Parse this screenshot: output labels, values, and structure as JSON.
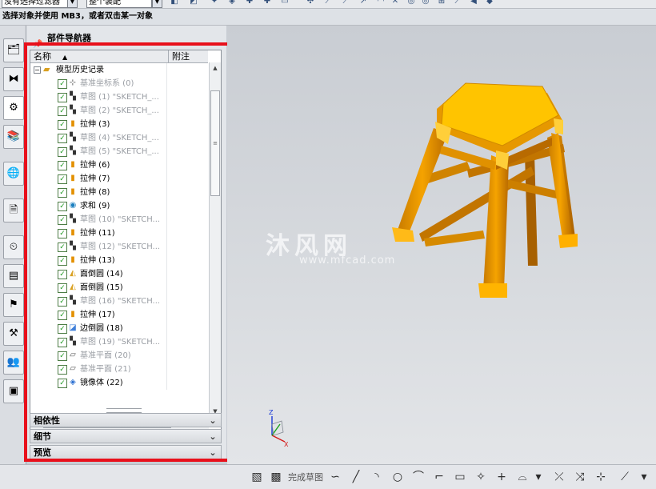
{
  "toolbar": {
    "selection_filter": "没有选择过滤器",
    "selection_scope": "整个装配"
  },
  "cue_line": "选择对象并使用 MB3，或者双击某一对象",
  "navigator": {
    "title": "部件导航器",
    "columns": {
      "name": "名称",
      "note": "附注"
    },
    "root_label": "模型历史记录",
    "features": [
      {
        "type": "datum-csys",
        "label": "基准坐标系 (0)",
        "suppressed": true
      },
      {
        "type": "sketch",
        "label": "草图 (1) \"SKETCH_...",
        "suppressed": true
      },
      {
        "type": "sketch",
        "label": "草图 (2) \"SKETCH_...",
        "suppressed": true
      },
      {
        "type": "extrude",
        "label": "拉伸 (3)",
        "suppressed": false
      },
      {
        "type": "sketch",
        "label": "草图 (4) \"SKETCH_...",
        "suppressed": true
      },
      {
        "type": "sketch",
        "label": "草图 (5) \"SKETCH_...",
        "suppressed": true
      },
      {
        "type": "extrude",
        "label": "拉伸 (6)",
        "suppressed": false
      },
      {
        "type": "extrude",
        "label": "拉伸 (7)",
        "suppressed": false
      },
      {
        "type": "extrude",
        "label": "拉伸 (8)",
        "suppressed": false
      },
      {
        "type": "unite",
        "label": "求和 (9)",
        "suppressed": false
      },
      {
        "type": "sketch",
        "label": "草图 (10) \"SKETCH...",
        "suppressed": true
      },
      {
        "type": "extrude",
        "label": "拉伸 (11)",
        "suppressed": false
      },
      {
        "type": "sketch",
        "label": "草图 (12) \"SKETCH...",
        "suppressed": true
      },
      {
        "type": "extrude",
        "label": "拉伸 (13)",
        "suppressed": false
      },
      {
        "type": "face-blend",
        "label": "面倒圆 (14)",
        "suppressed": false
      },
      {
        "type": "face-blend",
        "label": "面倒圆 (15)",
        "suppressed": false
      },
      {
        "type": "sketch",
        "label": "草图 (16) \"SKETCH...",
        "suppressed": true
      },
      {
        "type": "extrude",
        "label": "拉伸 (17)",
        "suppressed": false
      },
      {
        "type": "edge-blend",
        "label": "边倒圆 (18)",
        "suppressed": false
      },
      {
        "type": "sketch",
        "label": "草图 (19) \"SKETCH...",
        "suppressed": true
      },
      {
        "type": "datum-plane",
        "label": "基准平面 (20)",
        "suppressed": true
      },
      {
        "type": "datum-plane",
        "label": "基准平面 (21)",
        "suppressed": true
      },
      {
        "type": "mirror-body",
        "label": "镜像体 (22)",
        "suppressed": false
      }
    ],
    "sections": [
      "相依性",
      "细节",
      "预览"
    ]
  },
  "graphics": {
    "watermark_text": "沐风网",
    "watermark_url": "www.mfcad.com",
    "model_color": "#f0a000",
    "top_color": "#ffc400"
  },
  "bottom_toolbar": {
    "finish_sketch_label": "完成草图"
  }
}
